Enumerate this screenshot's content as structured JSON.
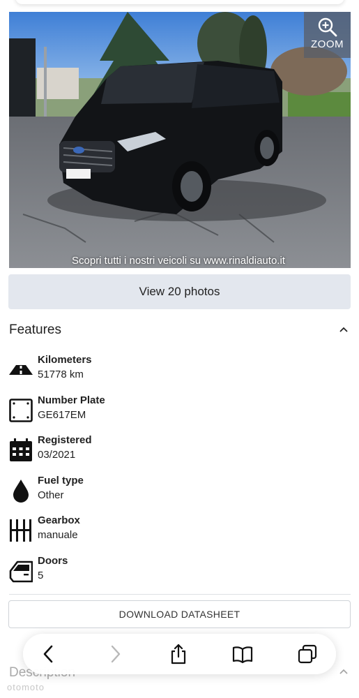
{
  "gallery": {
    "zoom_label": "ZOOM",
    "caption": "Scopri tutti i nostri veicoli su www.rinaldiauto.it",
    "view_photos_label": "View 20 photos"
  },
  "features": {
    "title": "Features",
    "items": [
      {
        "label": "Kilometers",
        "value": "51778 km",
        "icon": "road-icon"
      },
      {
        "label": "Number Plate",
        "value": "GE617EM",
        "icon": "plate-icon"
      },
      {
        "label": "Registered",
        "value": "03/2021",
        "icon": "calendar-icon"
      },
      {
        "label": "Fuel type",
        "value": "Other",
        "icon": "fuel-drop-icon"
      },
      {
        "label": "Gearbox",
        "value": "manuale",
        "icon": "gearbox-icon"
      },
      {
        "label": "Doors",
        "value": "5",
        "icon": "car-door-icon"
      }
    ]
  },
  "download_label": "DOWNLOAD DATASHEET",
  "description": {
    "title": "Description"
  },
  "watermark": "otomoto",
  "browser_bar": {
    "buttons": [
      "back-icon",
      "forward-icon",
      "share-icon",
      "bookmarks-icon",
      "tabs-icon"
    ]
  },
  "colors": {
    "accent_button": "#e3e7ee",
    "text": "#222222"
  }
}
